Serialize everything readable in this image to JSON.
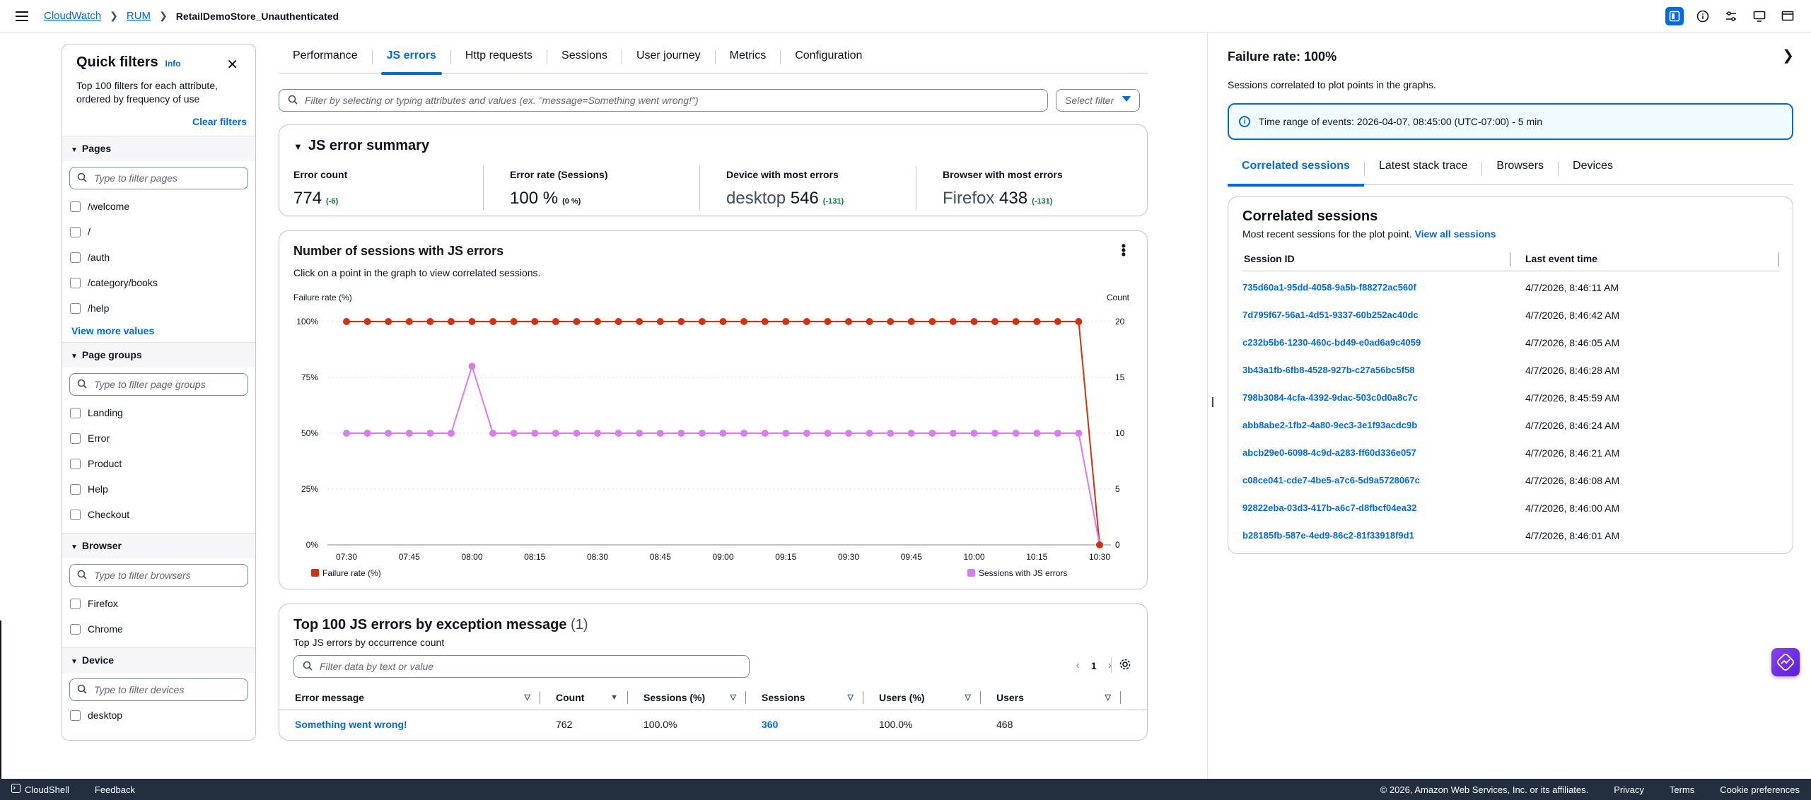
{
  "breadcrumb": {
    "root": "CloudWatch",
    "mid": "RUM",
    "current": "RetailDemoStore_Unauthenticated"
  },
  "quick_filters": {
    "title": "Quick filters",
    "info": "Info",
    "desc": "Top 100 filters for each attribute, ordered by frequency of use",
    "clear": "Clear filters",
    "pages": {
      "label": "Pages",
      "placeholder": "Type to filter pages",
      "items": [
        "/welcome",
        "/",
        "/auth",
        "/category/books",
        "/help"
      ],
      "more": "View more values"
    },
    "page_groups": {
      "label": "Page groups",
      "placeholder": "Type to filter page groups",
      "items": [
        "Landing",
        "Error",
        "Product",
        "Help",
        "Checkout"
      ]
    },
    "browser": {
      "label": "Browser",
      "placeholder": "Type to filter browsers",
      "items": [
        "Firefox",
        "Chrome"
      ]
    },
    "device": {
      "label": "Device",
      "placeholder": "Type to filter devices",
      "items": [
        "desktop"
      ]
    }
  },
  "tabs": [
    "Performance",
    "JS errors",
    "Http requests",
    "Sessions",
    "User journey",
    "Metrics",
    "Configuration"
  ],
  "filter": {
    "placeholder": "Filter by selecting or typing attributes and values (ex. \"message=Something went wrong!\")",
    "select": "Select filter"
  },
  "summary": {
    "title": "JS error summary",
    "metrics": [
      {
        "label": "Error count",
        "value": "774",
        "delta": "(-6)"
      },
      {
        "label": "Error rate (Sessions)",
        "value": "100 %",
        "delta": "(0 %)"
      },
      {
        "label": "Device with most errors",
        "name": "desktop",
        "value": "546",
        "delta": "(-131)"
      },
      {
        "label": "Browser with most errors",
        "name": "Firefox",
        "value": "438",
        "delta": "(-131)"
      }
    ]
  },
  "chart_card": {
    "title": "Number of sessions with JS errors",
    "subtitle": "Click on a point in the graph to view correlated sessions."
  },
  "chart_data": {
    "type": "line",
    "ylabel": "Failure rate (%)",
    "y2label": "Count",
    "ylim": [
      0,
      100
    ],
    "y2lim": [
      0,
      20
    ],
    "yticks": [
      "0%",
      "25%",
      "50%",
      "75%",
      "100%"
    ],
    "y2ticks": [
      "0",
      "5",
      "10",
      "15",
      "20"
    ],
    "xticks": [
      "07:30",
      "07:45",
      "08:00",
      "08:15",
      "08:30",
      "08:45",
      "09:00",
      "09:15",
      "09:30",
      "09:45",
      "10:00",
      "10:15",
      "10:30"
    ],
    "x": [
      "07:30",
      "07:35",
      "07:40",
      "07:45",
      "07:50",
      "07:55",
      "08:00",
      "08:05",
      "08:10",
      "08:15",
      "08:20",
      "08:25",
      "08:30",
      "08:35",
      "08:40",
      "08:45",
      "08:50",
      "08:55",
      "09:00",
      "09:05",
      "09:10",
      "09:15",
      "09:20",
      "09:25",
      "09:30",
      "09:35",
      "09:40",
      "09:45",
      "09:50",
      "09:55",
      "10:00",
      "10:05",
      "10:10",
      "10:15",
      "10:20",
      "10:25",
      "10:30"
    ],
    "series": [
      {
        "name": "Failure rate (%)",
        "color": "#d13212",
        "axis": "left",
        "values": [
          100,
          100,
          100,
          100,
          100,
          100,
          100,
          100,
          100,
          100,
          100,
          100,
          100,
          100,
          100,
          100,
          100,
          100,
          100,
          100,
          100,
          100,
          100,
          100,
          100,
          100,
          100,
          100,
          100,
          100,
          100,
          100,
          100,
          100,
          100,
          100,
          0
        ]
      },
      {
        "name": "Sessions with JS errors",
        "color": "#da7ced",
        "axis": "right",
        "values": [
          10,
          10,
          10,
          10,
          10,
          10,
          16,
          10,
          10,
          10,
          10,
          10,
          10,
          10,
          10,
          10,
          10,
          10,
          10,
          10,
          10,
          10,
          10,
          10,
          10,
          10,
          10,
          10,
          10,
          10,
          10,
          10,
          10,
          10,
          10,
          10,
          0
        ]
      }
    ],
    "grid": true,
    "legend": "bottom"
  },
  "top_errors": {
    "title": "Top 100 JS errors by exception message",
    "count": "(1)",
    "subtitle": "Top JS errors by occurrence count",
    "placeholder": "Filter data by text or value",
    "page": "1",
    "columns": [
      "Error message",
      "Count",
      "Sessions (%)",
      "Sessions",
      "Users (%)",
      "Users"
    ],
    "rows": [
      {
        "message": "Something went wrong!",
        "count": "762",
        "sessions_pct": "100.0%",
        "sessions": "360",
        "users_pct": "100.0%",
        "users": "468"
      }
    ]
  },
  "right_panel": {
    "title": "Failure rate: 100%",
    "subtitle": "Sessions correlated to plot points in the graphs.",
    "alert": "Time range of events: 2026-04-07, 08:45:00 (UTC-07:00) - 5 min",
    "tabs": [
      "Correlated sessions",
      "Latest stack trace",
      "Browsers",
      "Devices"
    ],
    "card_title": "Correlated sessions",
    "card_sub": "Most recent sessions for the plot point.",
    "view_all": "View all sessions",
    "col_session": "Session ID",
    "col_time": "Last event time",
    "sessions": [
      {
        "id": "735d60a1-95dd-4058-9a5b-f88272ac560f",
        "time": "4/7/2026, 8:46:11 AM"
      },
      {
        "id": "7d795f67-56a1-4d51-9337-60b252ac40dc",
        "time": "4/7/2026, 8:46:42 AM"
      },
      {
        "id": "c232b5b6-1230-460c-bd49-e0ad6a9c4059",
        "time": "4/7/2026, 8:46:05 AM"
      },
      {
        "id": "3b43a1fb-6fb8-4528-927b-c27a56bc5f58",
        "time": "4/7/2026, 8:46:28 AM"
      },
      {
        "id": "798b3084-4cfa-4392-9dac-503c0d0a8c7c",
        "time": "4/7/2026, 8:45:59 AM"
      },
      {
        "id": "abb8abe2-1fb2-4a80-9ec3-3e1f93acdc9b",
        "time": "4/7/2026, 8:46:24 AM"
      },
      {
        "id": "abcb29e0-6098-4c9d-a283-ff60d336e057",
        "time": "4/7/2026, 8:46:21 AM"
      },
      {
        "id": "c08ce041-cde7-4be5-a7c6-5d9a5728067c",
        "time": "4/7/2026, 8:46:08 AM"
      },
      {
        "id": "92822eba-03d3-417b-a6c7-d8fbcf04ea32",
        "time": "4/7/2026, 8:46:00 AM"
      },
      {
        "id": "b28185fb-587e-4ed9-86c2-81f33918f9d1",
        "time": "4/7/2026, 8:46:01 AM"
      }
    ]
  },
  "footer": {
    "cloudshell": "CloudShell",
    "feedback": "Feedback",
    "copyright": "© 2026, Amazon Web Services, Inc. or its affiliates.",
    "privacy": "Privacy",
    "terms": "Terms",
    "cookies": "Cookie preferences"
  }
}
